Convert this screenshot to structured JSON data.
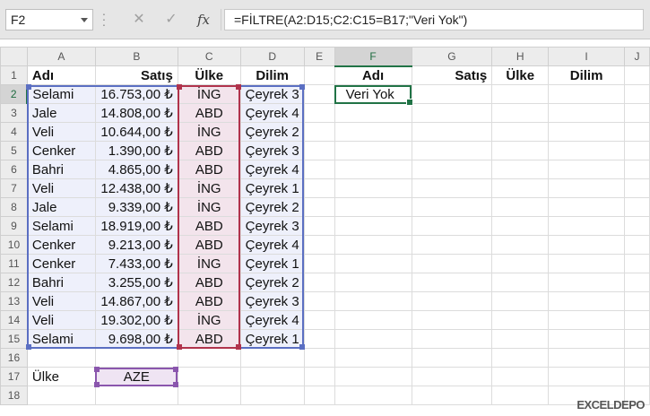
{
  "formula_bar": {
    "name_box": "F2",
    "cancel_icon": "close-icon",
    "enter_icon": "check-icon",
    "function_label": "fx",
    "formula": "=FİLTRE(A2:D15;C2:C15=B17;\"Veri Yok\")"
  },
  "columns": [
    "A",
    "B",
    "C",
    "D",
    "E",
    "F",
    "G",
    "H",
    "I",
    "J"
  ],
  "headers": {
    "A1": "Adı",
    "B1": "Satış",
    "C1": "Ülke",
    "D1": "Dilim",
    "F1": "Adı",
    "G1": "Satış",
    "H1": "Ülke",
    "I1": "Dilim"
  },
  "rows": [
    {
      "n": "2",
      "a": "Selami",
      "b": "16.753,00 ₺",
      "c": "İNG",
      "d": "Çeyrek 3"
    },
    {
      "n": "3",
      "a": "Jale",
      "b": "14.808,00 ₺",
      "c": "ABD",
      "d": "Çeyrek 4"
    },
    {
      "n": "4",
      "a": "Veli",
      "b": "10.644,00 ₺",
      "c": "İNG",
      "d": "Çeyrek 2"
    },
    {
      "n": "5",
      "a": "Cenker",
      "b": "1.390,00 ₺",
      "c": "ABD",
      "d": "Çeyrek 3"
    },
    {
      "n": "6",
      "a": "Bahri",
      "b": "4.865,00 ₺",
      "c": "ABD",
      "d": "Çeyrek 4"
    },
    {
      "n": "7",
      "a": "Veli",
      "b": "12.438,00 ₺",
      "c": "İNG",
      "d": "Çeyrek 1"
    },
    {
      "n": "8",
      "a": "Jale",
      "b": "9.339,00 ₺",
      "c": "İNG",
      "d": "Çeyrek 2"
    },
    {
      "n": "9",
      "a": "Selami",
      "b": "18.919,00 ₺",
      "c": "ABD",
      "d": "Çeyrek 3"
    },
    {
      "n": "10",
      "a": "Cenker",
      "b": "9.213,00 ₺",
      "c": "ABD",
      "d": "Çeyrek 4"
    },
    {
      "n": "11",
      "a": "Cenker",
      "b": "7.433,00 ₺",
      "c": "İNG",
      "d": "Çeyrek 1"
    },
    {
      "n": "12",
      "a": "Bahri",
      "b": "3.255,00 ₺",
      "c": "ABD",
      "d": "Çeyrek 2"
    },
    {
      "n": "13",
      "a": "Veli",
      "b": "14.867,00 ₺",
      "c": "ABD",
      "d": "Çeyrek 3"
    },
    {
      "n": "14",
      "a": "Veli",
      "b": "19.302,00 ₺",
      "c": "İNG",
      "d": "Çeyrek 4"
    },
    {
      "n": "15",
      "a": "Selami",
      "b": "9.698,00 ₺",
      "c": "ABD",
      "d": "Çeyrek 1"
    }
  ],
  "result": {
    "F2": "Veri Yok"
  },
  "criteria": {
    "label": "Ülke",
    "value": "AZE"
  },
  "row_numbers": {
    "r1": "1",
    "r16": "16",
    "r17": "17",
    "r18": "18"
  },
  "watermark": "EXCELDEPO",
  "colors": {
    "accent": "#217346",
    "range_blue": "#5b6fc2",
    "range_red": "#b0334c",
    "range_purple": "#8a56ad"
  }
}
